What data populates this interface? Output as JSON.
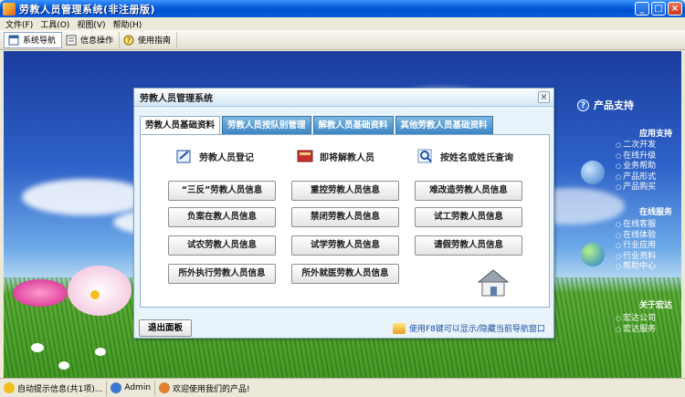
{
  "window": {
    "title": "劳教人员管理系统(非注册版)"
  },
  "menu": [
    "文件(F)",
    "工具(O)",
    "视图(V)",
    "帮助(H)"
  ],
  "toolbar": {
    "nav_label": "系统导航",
    "info_label": "信息操作",
    "guide_label": "使用指南"
  },
  "dialog": {
    "title": "劳教人员管理系统",
    "close": "×",
    "tabs": [
      "劳教人员基础资料",
      "劳教人员按队别管理",
      "解教人员基础资料",
      "其他劳教人员基础资料"
    ],
    "actions": [
      "劳教人员登记",
      "即将解教人员",
      "按姓名或姓氏查询"
    ],
    "buttons": [
      "“三反”劳教人员信息",
      "重控劳教人员信息",
      "难改造劳教人员信息",
      "负案在教人员信息",
      "禁闭劳教人员信息",
      "试工劳教人员信息",
      "试农劳教人员信息",
      "试学劳教人员信息",
      "请假劳教人员信息",
      "所外执行劳教人员信息",
      "所外就医劳教人员信息"
    ],
    "exit_label": "退出面板",
    "hint": "使用F8键可以显示/隐藏当前导航窗口"
  },
  "side_panel": {
    "title": "产品支持",
    "sections": [
      {
        "heading": "应用支持",
        "items": [
          "二次开发",
          "在线升级",
          "业务帮助",
          "产品形式",
          "产品购买"
        ]
      },
      {
        "heading": "在线服务",
        "items": [
          "在线客服",
          "在线体验",
          "行业应用",
          "行业资料",
          "帮助中心"
        ]
      },
      {
        "heading": "关于宏达",
        "items": [
          "宏达公司",
          "宏达服务"
        ]
      }
    ]
  },
  "statusbar": {
    "auto_info": "自动提示信息(共1项)...",
    "user": "Admin",
    "welcome": "欢迎使用我们的产品!"
  },
  "colors": {
    "titlebar": "#0A5FDB",
    "tab_active": "#FFFFFF",
    "tab_inactive": "#3B85C4",
    "dialog_bg": "#E8F3FB"
  }
}
